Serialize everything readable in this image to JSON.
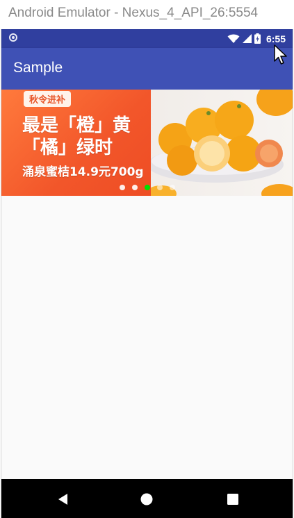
{
  "window": {
    "title": "Android Emulator - Nexus_4_API_26:5554"
  },
  "status_bar": {
    "time": "6:55",
    "background": "#303f9f",
    "icons": [
      "notification-icon",
      "wifi-icon",
      "signal-icon",
      "battery-charging-icon"
    ]
  },
  "app_bar": {
    "title": "Sample",
    "background": "#3f51b5"
  },
  "banner": {
    "tag": "秋令进补",
    "headline": "最是「橙」黄「橘」绿时",
    "subline": "涌泉蜜桔14.9元700g",
    "accent": "#f2562a",
    "dots": [
      {
        "state": "inactive"
      },
      {
        "state": "inactive"
      },
      {
        "state": "active"
      },
      {
        "state": "inactive"
      },
      {
        "state": "inactive"
      }
    ],
    "active_dot_color": "#00e000"
  },
  "nav_bar": {
    "buttons": [
      "back",
      "home",
      "recents"
    ]
  }
}
